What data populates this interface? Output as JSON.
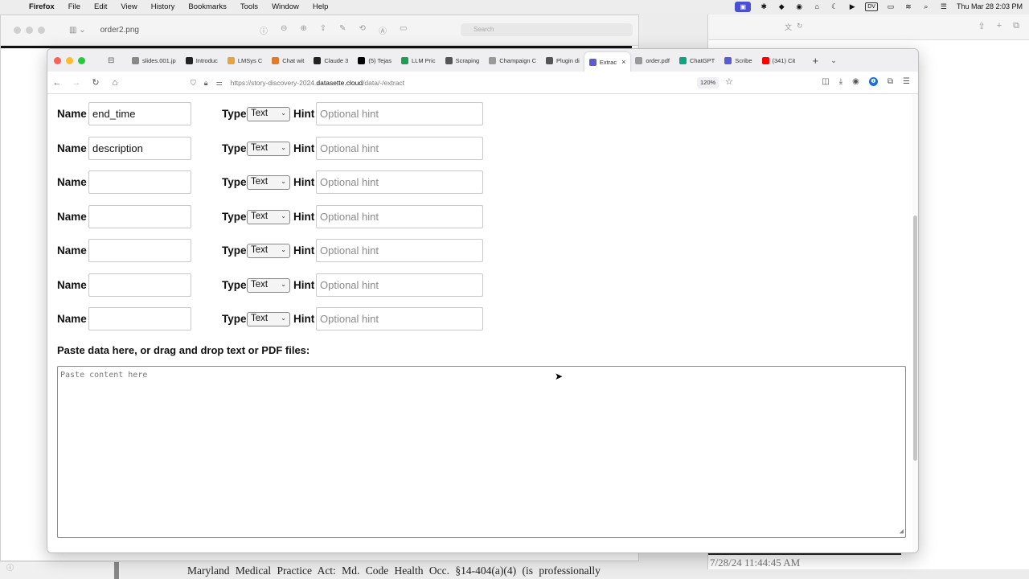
{
  "menubar": {
    "app": "Firefox",
    "items": [
      "File",
      "Edit",
      "View",
      "History",
      "Bookmarks",
      "Tools",
      "Window",
      "Help"
    ],
    "status_dv": "DV",
    "datetime": "Thu Mar 28  2:03 PM"
  },
  "preview_window": {
    "title": "order2.png",
    "search_placeholder": "Search",
    "footer_text": "Maryland Medical Practice Act: Md. Code Health Occ. §14-404(a)(4) (is professionally",
    "side_footer": "7/28/24  11:44:45 AM"
  },
  "browser": {
    "tabs": [
      {
        "label": "slides.001.jp",
        "icon": "image-icon",
        "color": "#888888"
      },
      {
        "label": "Introduc",
        "icon": "anthropic-icon",
        "color": "#222222"
      },
      {
        "label": "LMSys C",
        "icon": "lmsys-icon",
        "color": "#e8a33a"
      },
      {
        "label": "Chat wit",
        "icon": "chat-icon",
        "color": "#e07b2a"
      },
      {
        "label": "Claude 3",
        "icon": "anthropic-icon",
        "color": "#222222"
      },
      {
        "label": "(5) Tejas",
        "icon": "x-icon",
        "color": "#000000"
      },
      {
        "label": "LLM Pric",
        "icon": "sheet-icon",
        "color": "#1f9d55"
      },
      {
        "label": "Scraping",
        "icon": "page-icon",
        "color": "#555555"
      },
      {
        "label": "Champaign C",
        "icon": "page-icon",
        "color": "#999999"
      },
      {
        "label": "Plugin di",
        "icon": "page-icon",
        "color": "#555555"
      },
      {
        "label": "Extrac",
        "icon": "datasette-icon",
        "color": "#5b5bd6",
        "active": true
      },
      {
        "label": "order.pdf",
        "icon": "pdf-icon",
        "color": "#999999"
      },
      {
        "label": "ChatGPT",
        "icon": "chatgpt-icon",
        "color": "#10a37f"
      },
      {
        "label": "Scribe",
        "icon": "page-icon",
        "color": "#5b5bd6"
      },
      {
        "label": "(341) Cit",
        "icon": "youtube-icon",
        "color": "#ff0000"
      }
    ],
    "url_prefix": "https://story-discovery-2024.",
    "url_host": "datasette.cloud",
    "url_path": "/data/-/extract",
    "zoom": "120%"
  },
  "form": {
    "name_label": "Name",
    "type_label": "Type",
    "hint_label": "Hint",
    "rows": [
      {
        "name": "end_time",
        "type": "Text",
        "hint_placeholder": "Optional hint"
      },
      {
        "name": "description",
        "type": "Text",
        "hint_placeholder": "Optional hint"
      },
      {
        "name": "",
        "type": "Text",
        "hint_placeholder": "Optional hint"
      },
      {
        "name": "",
        "type": "Text",
        "hint_placeholder": "Optional hint"
      },
      {
        "name": "",
        "type": "Text",
        "hint_placeholder": "Optional hint"
      },
      {
        "name": "",
        "type": "Text",
        "hint_placeholder": "Optional hint"
      },
      {
        "name": "",
        "type": "Text",
        "hint_placeholder": "Optional hint"
      }
    ],
    "paste_label": "Paste data here, or drag and drop text or PDF files:",
    "paste_placeholder": "Paste content here"
  }
}
